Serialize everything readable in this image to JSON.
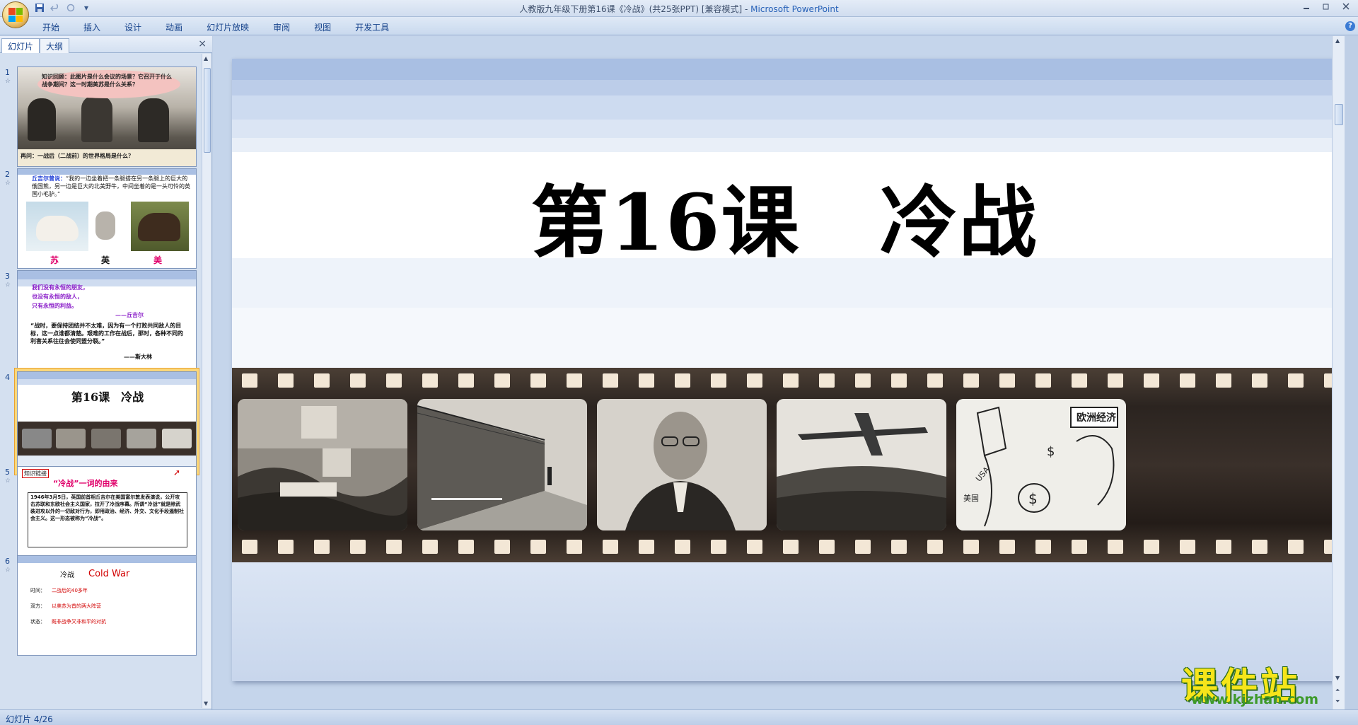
{
  "window": {
    "title": "人教版九年级下册第16课《冷战》(共25张PPT) [兼容模式]",
    "title_separator": " - ",
    "app_name": "Microsoft PowerPoint",
    "controls": [
      "minimize-icon",
      "restore-icon",
      "close-icon"
    ]
  },
  "quick_access": [
    "save-icon",
    "undo-icon",
    "redo-icon",
    "customize-icon"
  ],
  "ribbon": {
    "tabs": [
      "开始",
      "插入",
      "设计",
      "动画",
      "幻灯片放映",
      "审阅",
      "视图",
      "开发工具"
    ]
  },
  "panel": {
    "tabs": [
      "幻灯片",
      "大纲"
    ],
    "close": "×"
  },
  "thumbnails": [
    {
      "num": "1",
      "question": "知识回顾：此图片是什么会议的场景？它召开于什么战争期间？这一时期美苏是什么关系？",
      "question2": "再问：一战后（二战前）的世界格局是什么？"
    },
    {
      "num": "2",
      "quote_speaker": "丘吉尔曾说：",
      "quote": "“我的一边坐着把一条腿搭在另一条腿上的巨大的俄国熊，另一边是巨大的北美野牛，中间坐着的是一头可怜的英国小毛驴。”",
      "labels": [
        "苏",
        "英",
        "美"
      ]
    },
    {
      "num": "3",
      "lines": [
        "我们没有永恒的朋友，",
        "也没有永恒的敌人，",
        "只有永恒的利益。"
      ],
      "author1": "——丘吉尔",
      "quote": "“战时，要保持团结并不太难，因为有一个打败共同敌人的目标，这一点谁都清楚。艰难的工作在战后，那时，各种不同的利害关系往往会使同盟分裂。”",
      "author2": "——斯大林"
    },
    {
      "num": "4",
      "title": "第16课　冷战",
      "selected": true
    },
    {
      "num": "5",
      "tag": "知识链接",
      "heading": "“冷战”一词的由来",
      "body": "1946年3月5日，英国前首相丘吉尔在美国富尔敦发表演说，公开攻击苏联和东欧社会主义国家，拉开了冷战序幕。所谓“冷战”就是除武装进攻以外的一切敌对行为，即用政治、经济、外交、文化手段遏制社会主义。这一形态被称为“冷战”。"
    },
    {
      "num": "6",
      "label": "冷战",
      "english": "Cold War",
      "rows": [
        {
          "k": "时间：",
          "v": "二战后的40多年"
        },
        {
          "k": "双方：",
          "v": "以美苏为首的两大阵营"
        },
        {
          "k": "状态：",
          "v": "既非战争又非和平的对抗"
        }
      ]
    }
  ],
  "slide": {
    "title": "第16课　冷战",
    "frames": [
      "congress-photo",
      "berlin-wall-photo",
      "truman-portrait",
      "berlin-airlift-photo",
      "marshall-plan-cartoon"
    ],
    "cartoon_label": "欧洲经济",
    "cartoon_usa": "USA",
    "cartoon_country": "美国"
  },
  "watermark": {
    "title": "课件站",
    "url": "www.kjzhan.com"
  },
  "status": {
    "text": "幻灯片 4/26"
  },
  "colors": {
    "ribbon": "#dfe9f6",
    "selected_thumb": "#fbd77a",
    "band_blue": "#a9bfe3",
    "watermark_yellow": "#f6e51a",
    "watermark_green": "#3e9a2a"
  }
}
